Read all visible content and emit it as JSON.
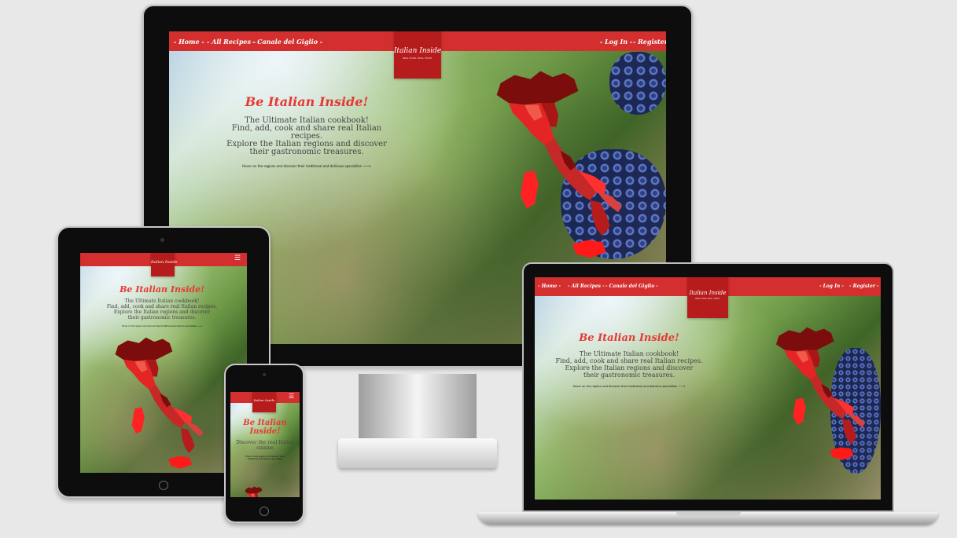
{
  "site": {
    "nav_links": [
      "- Home -",
      "- All Recipes -",
      "- Canale del Giglio -"
    ],
    "nav_right": [
      "- Log In -",
      "- Register -"
    ],
    "logo_title": "Italian Inside",
    "logo_subtitle": "REAL FOOD. REAL TASTE.",
    "hero_title": "Be Italian Inside!",
    "hero_lines": [
      "The Ultimate Italian cookbook!",
      "Find, add, cook and share real Italian recipes.",
      "Explore the Italian regions and discover",
      "their gastronomic treasures."
    ],
    "hint": "Hover on the regions and discover their traditional and delicious specialties 🡒",
    "mobile_title_1": "Be Italian",
    "mobile_title_2": "Inside!",
    "mobile_lines": [
      "Discover the real Italian",
      "cuisine"
    ],
    "mobile_hint_1": "Hover on the regions and discover their",
    "mobile_hint_2": "traditional and delicious specialties",
    "menu_icon": "hamburger-menu-icon"
  },
  "devices": [
    "desktop-monitor",
    "tablet",
    "laptop",
    "smartphone"
  ],
  "colors": {
    "nav_red": "#d32f2f",
    "logo_red": "#b71c1c",
    "title_red": "#e53935",
    "map_dark": "#7b0d0d",
    "map_mid": "#c62828",
    "map_bright": "#ff1a1a",
    "map_light": "#f05a4a"
  }
}
